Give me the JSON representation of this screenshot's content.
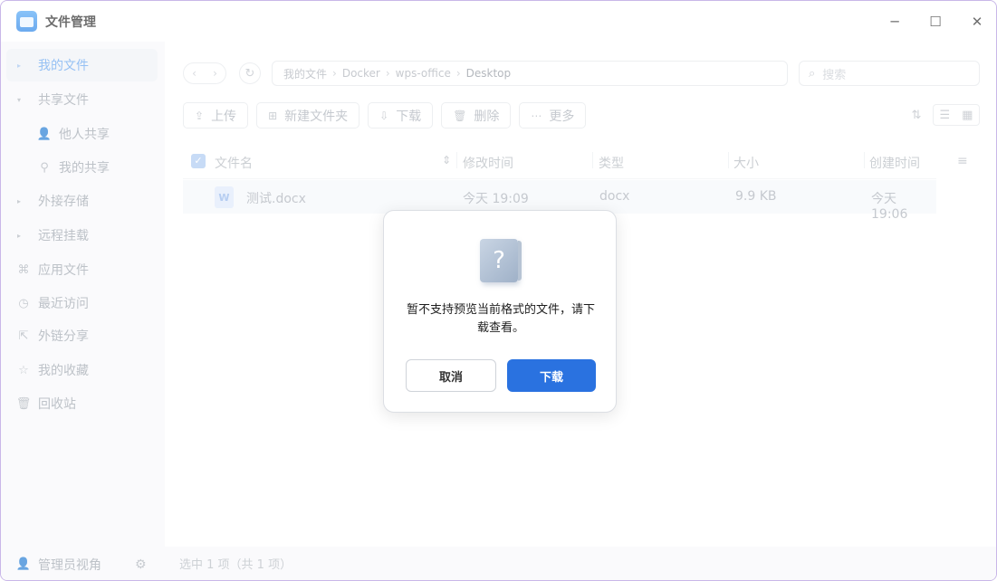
{
  "window": {
    "title": "文件管理",
    "minimize": "─",
    "maximize": "☐",
    "close": "✕"
  },
  "sidebar": {
    "items": [
      {
        "label": "我的文件",
        "caret": "▸"
      },
      {
        "label": "共享文件",
        "caret": "▾"
      },
      {
        "label": "他人共享",
        "icon": "👤"
      },
      {
        "label": "我的共享",
        "icon": "⚲"
      },
      {
        "label": "外接存储",
        "caret": "▸"
      },
      {
        "label": "远程挂载",
        "caret": "▸"
      },
      {
        "label": "应用文件",
        "icon": "⌘"
      },
      {
        "label": "最近访问",
        "icon": "◷"
      },
      {
        "label": "外链分享",
        "icon": "⇱"
      },
      {
        "label": "我的收藏",
        "icon": "☆"
      },
      {
        "label": "回收站",
        "icon": "🗑"
      }
    ],
    "bottom_label": "管理员视角",
    "bottom_gear": "⚙"
  },
  "main": {
    "nav_back": "‹",
    "nav_forward": "›",
    "refresh": "↻",
    "breadcrumb": [
      "我的文件",
      "Docker",
      "wps-office",
      "Desktop"
    ],
    "crumb_sep": "›",
    "search_placeholder": "搜索",
    "search_icon": "⌕",
    "toolbar": [
      {
        "label": "上传",
        "icon": "⇪"
      },
      {
        "label": "新建文件夹",
        "icon": "⊞"
      },
      {
        "label": "下载",
        "icon": "⇩"
      },
      {
        "label": "删除",
        "icon": "🗑"
      },
      {
        "label": "更多",
        "icon": "⋯"
      }
    ],
    "sort_icon": "⇅",
    "list_icon": "☰",
    "grid_icon": "▦",
    "columns": [
      "文件名",
      "修改时间",
      "类型",
      "大小",
      "创建时间"
    ],
    "check_mark": "✓",
    "name_sort_icon": "⇕",
    "column_settings_icon": "≡",
    "rows": [
      {
        "icon_letter": "W",
        "name": "测试.docx",
        "modified": "今天 19:09",
        "type": "docx",
        "size": "9.9 KB",
        "created": "今天 19:06"
      }
    ],
    "status": "选中 1 项（共 1 项）"
  },
  "dialog": {
    "icon": "?",
    "message": "暂不支持预览当前格式的文件，请下载查看。",
    "cancel": "取消",
    "download": "下载"
  }
}
